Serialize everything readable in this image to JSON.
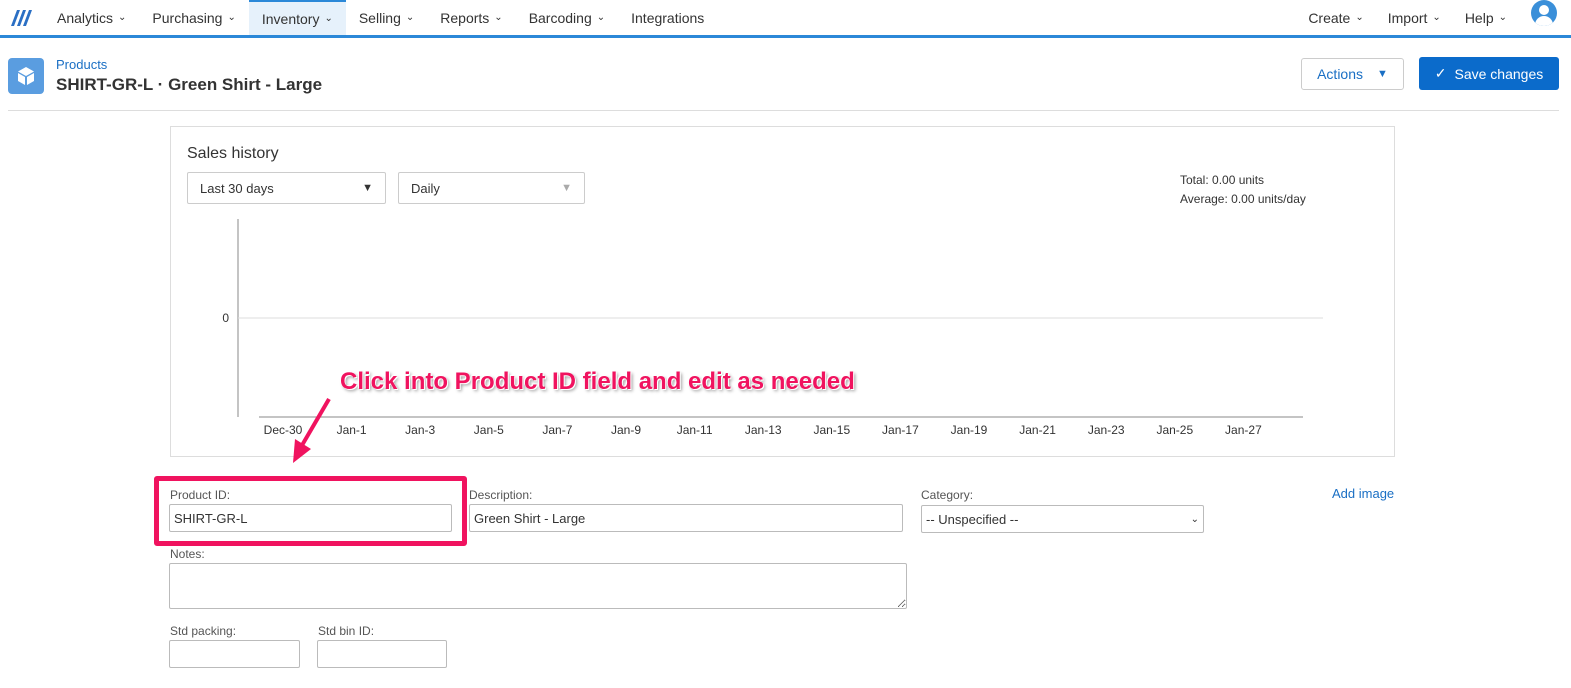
{
  "nav": {
    "items": [
      {
        "label": "Analytics",
        "dropdown": true
      },
      {
        "label": "Purchasing",
        "dropdown": true
      },
      {
        "label": "Inventory",
        "dropdown": true,
        "active": true
      },
      {
        "label": "Selling",
        "dropdown": true
      },
      {
        "label": "Reports",
        "dropdown": true
      },
      {
        "label": "Barcoding",
        "dropdown": true
      },
      {
        "label": "Integrations",
        "dropdown": false
      }
    ],
    "right": [
      {
        "label": "Create"
      },
      {
        "label": "Import"
      },
      {
        "label": "Help"
      }
    ]
  },
  "header": {
    "breadcrumb": "Products",
    "title": "SHIRT-GR-L · Green Shirt - Large",
    "actions_label": "Actions",
    "save_label": "Save changes"
  },
  "sales": {
    "title": "Sales history",
    "range": "Last 30 days",
    "interval": "Daily",
    "total": "Total: 0.00 units",
    "average": "Average: 0.00 units/day"
  },
  "chart_data": {
    "type": "line",
    "categories": [
      "Dec-30",
      "Jan-1",
      "Jan-3",
      "Jan-5",
      "Jan-7",
      "Jan-9",
      "Jan-11",
      "Jan-13",
      "Jan-15",
      "Jan-17",
      "Jan-19",
      "Jan-21",
      "Jan-23",
      "Jan-25",
      "Jan-27"
    ],
    "yticks": [
      0
    ],
    "grid": true
  },
  "form": {
    "product_id_label": "Product ID:",
    "product_id": "SHIRT-GR-L",
    "description_label": "Description:",
    "description": "Green Shirt - Large",
    "category_label": "Category:",
    "category": "-- Unspecified --",
    "add_image": "Add image",
    "notes_label": "Notes:",
    "notes": "",
    "std_packing_label": "Std packing:",
    "std_packing": "",
    "std_bin_label": "Std bin ID:",
    "std_bin": ""
  },
  "annotation": {
    "text": "Click into Product ID field and edit as needed",
    "color": "#f0135f"
  },
  "colors": {
    "accent": "#2b88d8",
    "primary_button": "#0b6bcb"
  }
}
